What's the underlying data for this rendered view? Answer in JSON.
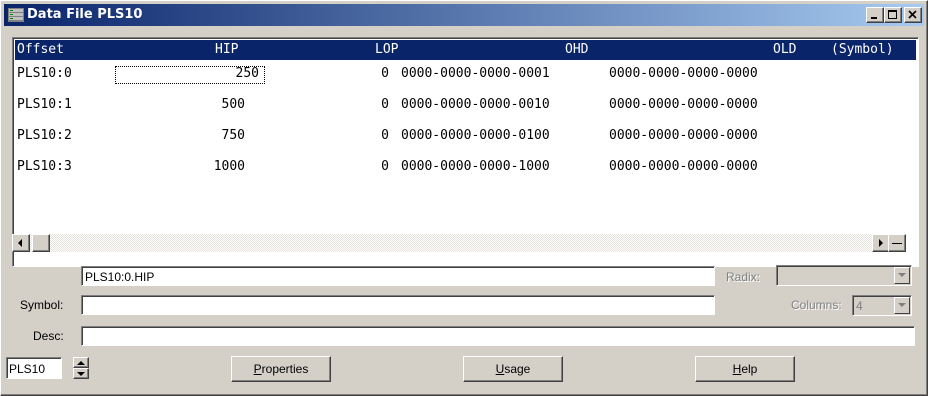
{
  "window": {
    "title": "Data File PLS10",
    "title_icon": "data-file-icon",
    "controls": [
      "minimize-icon",
      "maximize-icon",
      "close-icon"
    ]
  },
  "grid": {
    "headers": {
      "offset": "Offset",
      "hip": "HIP",
      "lop": "LOP",
      "ohd": "OHD",
      "old": "OLD",
      "symbol": "(Symbol)"
    },
    "rows": [
      {
        "offset": "PLS10:0",
        "hip": "250",
        "lop": "0",
        "ohd": "0000-0000-0000-0001",
        "old": "0000-0000-0000-0000"
      },
      {
        "offset": "PLS10:1",
        "hip": "500",
        "lop": "0",
        "ohd": "0000-0000-0000-0010",
        "old": "0000-0000-0000-0000"
      },
      {
        "offset": "PLS10:2",
        "hip": "750",
        "lop": "0",
        "ohd": "0000-0000-0000-0100",
        "old": "0000-0000-0000-0000"
      },
      {
        "offset": "PLS10:3",
        "hip": "1000",
        "lop": "0",
        "ohd": "0000-0000-0000-1000",
        "old": "0000-0000-0000-0000"
      }
    ]
  },
  "address": {
    "value": "PLS10:0.HIP"
  },
  "radix": {
    "label": "Radix:",
    "value": ""
  },
  "symbol": {
    "label": "Symbol:",
    "value": ""
  },
  "columns": {
    "label": "Columns:",
    "value": "4"
  },
  "desc": {
    "label": "Desc:",
    "value": ""
  },
  "file_selector": {
    "value": "PLS10"
  },
  "buttons": {
    "properties_access": "P",
    "properties_rest": "roperties",
    "usage_access": "U",
    "usage_rest": "sage",
    "help_access": "H",
    "help_rest": "elp"
  },
  "colors": {
    "title_start": "#0a246a",
    "title_end": "#a6caf0",
    "face": "#d4d0c8"
  }
}
